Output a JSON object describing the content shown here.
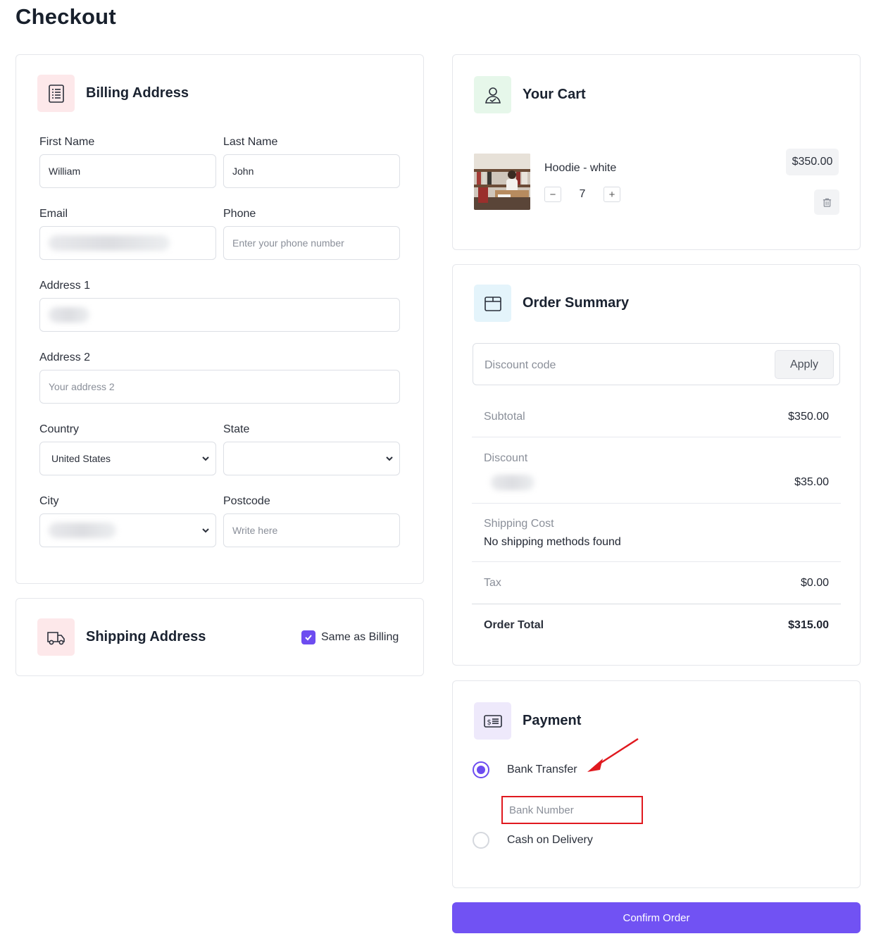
{
  "page": {
    "title": "Checkout"
  },
  "billing": {
    "title": "Billing Address",
    "first_name_label": "First Name",
    "first_name_value": "William",
    "last_name_label": "Last Name",
    "last_name_value": "John",
    "email_label": "Email",
    "phone_label": "Phone",
    "phone_placeholder": "Enter your phone number",
    "address1_label": "Address 1",
    "address2_label": "Address 2",
    "address2_placeholder": "Your address 2",
    "country_label": "Country",
    "country_value": "United States",
    "state_label": "State",
    "state_value": "",
    "city_label": "City",
    "postcode_label": "Postcode",
    "postcode_placeholder": "Write here"
  },
  "shipping": {
    "title": "Shipping Address",
    "same_as_billing_label": "Same as Billing",
    "same_as_billing_checked": true
  },
  "cart": {
    "title": "Your Cart",
    "items": [
      {
        "name": "Hoodie - white",
        "quantity": "7",
        "price": "$350.00",
        "minus": "−",
        "plus": "+"
      }
    ]
  },
  "summary": {
    "title": "Order Summary",
    "discount_placeholder": "Discount code",
    "apply_label": "Apply",
    "subtotal_label": "Subtotal",
    "subtotal_value": "$350.00",
    "discount_label": "Discount",
    "discount_value": "$35.00",
    "shipping_label": "Shipping Cost",
    "shipping_value": "No shipping methods found",
    "tax_label": "Tax",
    "tax_value": "$0.00",
    "total_label": "Order Total",
    "total_value": "$315.00"
  },
  "payment": {
    "title": "Payment",
    "options": [
      {
        "label": "Bank Transfer",
        "selected": true
      },
      {
        "label": "Cash on Delivery",
        "selected": false
      }
    ],
    "bank_number_placeholder": "Bank Number"
  },
  "actions": {
    "confirm_label": "Confirm Order"
  },
  "colors": {
    "accent": "#7152f3",
    "billing_icon_bg": "#fde8ea",
    "cart_icon_bg": "#e6f7ea",
    "summary_icon_bg": "#e4f4fb",
    "payment_icon_bg": "#eee9fb",
    "annotation_red": "#e0191f"
  }
}
